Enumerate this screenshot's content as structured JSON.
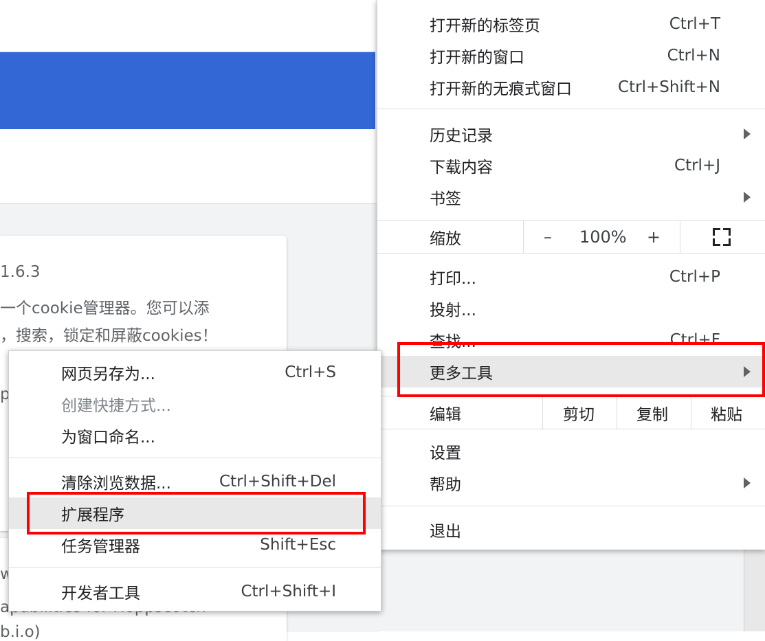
{
  "background": {
    "card": {
      "version_line": "1.6.3",
      "desc_line1": "一个cookie管理器。您可以添",
      "desc_line2": "，搜索，锁定和屏蔽cookies！",
      "fragment_p": "p",
      "fragment_w": "w",
      "fragment_bottom1": "apabilities for Hoppscotch",
      "fragment_bottom2": "b.i.o)"
    },
    "colors": {
      "header_blue": "#3367d6",
      "page_grey": "#f1f3f4"
    }
  },
  "main_menu": {
    "new_tab": {
      "label": "打开新的标签页",
      "shortcut": "Ctrl+T"
    },
    "new_window": {
      "label": "打开新的窗口",
      "shortcut": "Ctrl+N"
    },
    "incognito": {
      "label": "打开新的无痕式窗口",
      "shortcut": "Ctrl+Shift+N"
    },
    "history": {
      "label": "历史记录"
    },
    "downloads": {
      "label": "下载内容",
      "shortcut": "Ctrl+J"
    },
    "bookmarks": {
      "label": "书签"
    },
    "zoom": {
      "label": "缩放",
      "minus": "–",
      "value": "100%",
      "plus": "+"
    },
    "print": {
      "label": "打印...",
      "shortcut": "Ctrl+P"
    },
    "cast": {
      "label": "投射..."
    },
    "find": {
      "label": "查找...",
      "shortcut": "Ctrl+F"
    },
    "more_tools": {
      "label": "更多工具"
    },
    "edit": {
      "label": "编辑",
      "cut": "剪切",
      "copy": "复制",
      "paste": "粘贴"
    },
    "settings": {
      "label": "设置"
    },
    "help": {
      "label": "帮助"
    },
    "exit": {
      "label": "退出"
    }
  },
  "sub_menu": {
    "save_page": {
      "label": "网页另存为...",
      "shortcut": "Ctrl+S"
    },
    "create_shortcut": {
      "label": "创建快捷方式..."
    },
    "name_window": {
      "label": "为窗口命名..."
    },
    "clear_data": {
      "label": "清除浏览数据...",
      "shortcut": "Ctrl+Shift+Del"
    },
    "extensions": {
      "label": "扩展程序"
    },
    "task_manager": {
      "label": "任务管理器",
      "shortcut": "Shift+Esc"
    },
    "dev_tools": {
      "label": "开发者工具",
      "shortcut": "Ctrl+Shift+I"
    }
  },
  "highlight_color": "#ff0000"
}
